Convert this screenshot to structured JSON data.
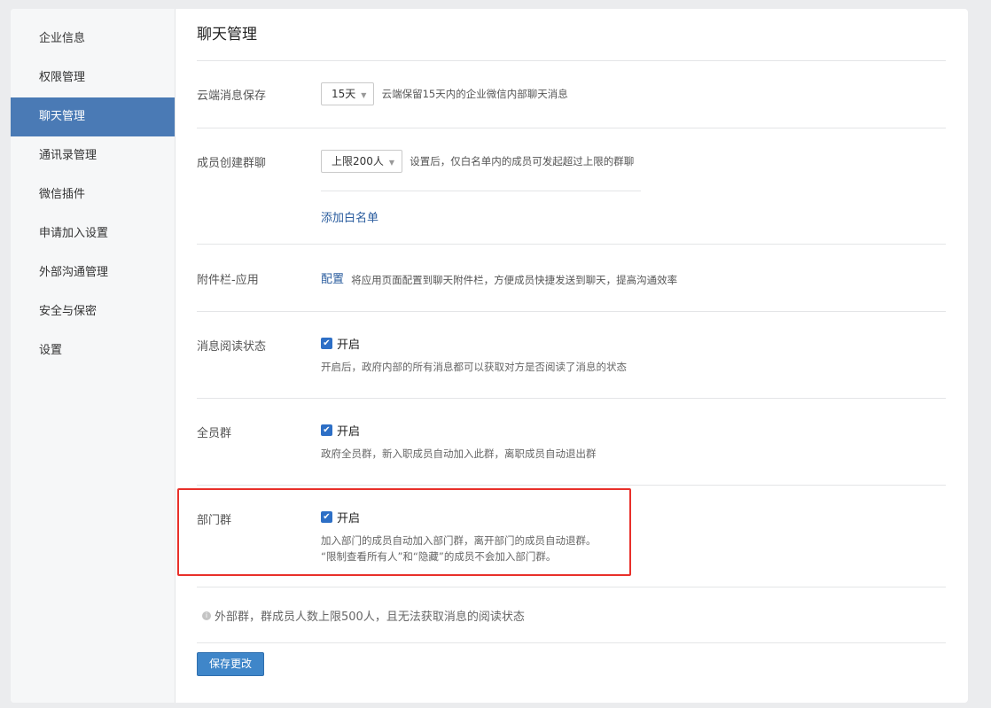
{
  "sidebar": {
    "items": [
      {
        "label": "企业信息"
      },
      {
        "label": "权限管理"
      },
      {
        "label": "聊天管理"
      },
      {
        "label": "通讯录管理"
      },
      {
        "label": "微信插件"
      },
      {
        "label": "申请加入设置"
      },
      {
        "label": "外部沟通管理"
      },
      {
        "label": "安全与保密"
      },
      {
        "label": "设置"
      }
    ],
    "active_index": 2
  },
  "page": {
    "title": "聊天管理"
  },
  "cloud_msg": {
    "label": "云端消息保存",
    "select_value": "15天",
    "hint": "云端保留15天内的企业微信内部聊天消息"
  },
  "group_create": {
    "label": "成员创建群聊",
    "select_value": "上限200人",
    "hint": "设置后，仅白名单内的成员可发起超过上限的群聊",
    "add_whitelist": "添加白名单"
  },
  "attachment": {
    "label": "附件栏-应用",
    "config_link": "配置",
    "hint": "将应用页面配置到聊天附件栏，方便成员快捷发送到聊天，提高沟通效率"
  },
  "read_status": {
    "label": "消息阅读状态",
    "checked": true,
    "check_label": "开启",
    "desc": "开启后，政府内部的所有消息都可以获取对方是否阅读了消息的状态"
  },
  "all_group": {
    "label": "全员群",
    "checked": true,
    "check_label": "开启",
    "desc": "政府全员群，新入职成员自动加入此群，离职成员自动退出群"
  },
  "dept_group": {
    "label": "部门群",
    "checked": true,
    "check_label": "开启",
    "desc1": "加入部门的成员自动加入部门群，离开部门的成员自动退群。",
    "desc2": "“限制查看所有人”和“隐藏”的成员不会加入部门群。"
  },
  "external_note": "外部群，群成员人数上限500人，且无法获取消息的阅读状态",
  "save_button": "保存更改",
  "icons": {
    "dropdown": "chevron-down-icon",
    "checkbox": "check-icon",
    "info": "info-icon"
  },
  "colors": {
    "accent": "#4a7ab5",
    "checkbox": "#2d6fc6",
    "link": "#2a5c9e",
    "highlight_border": "#e8302a",
    "save_button": "#3f86c9"
  }
}
